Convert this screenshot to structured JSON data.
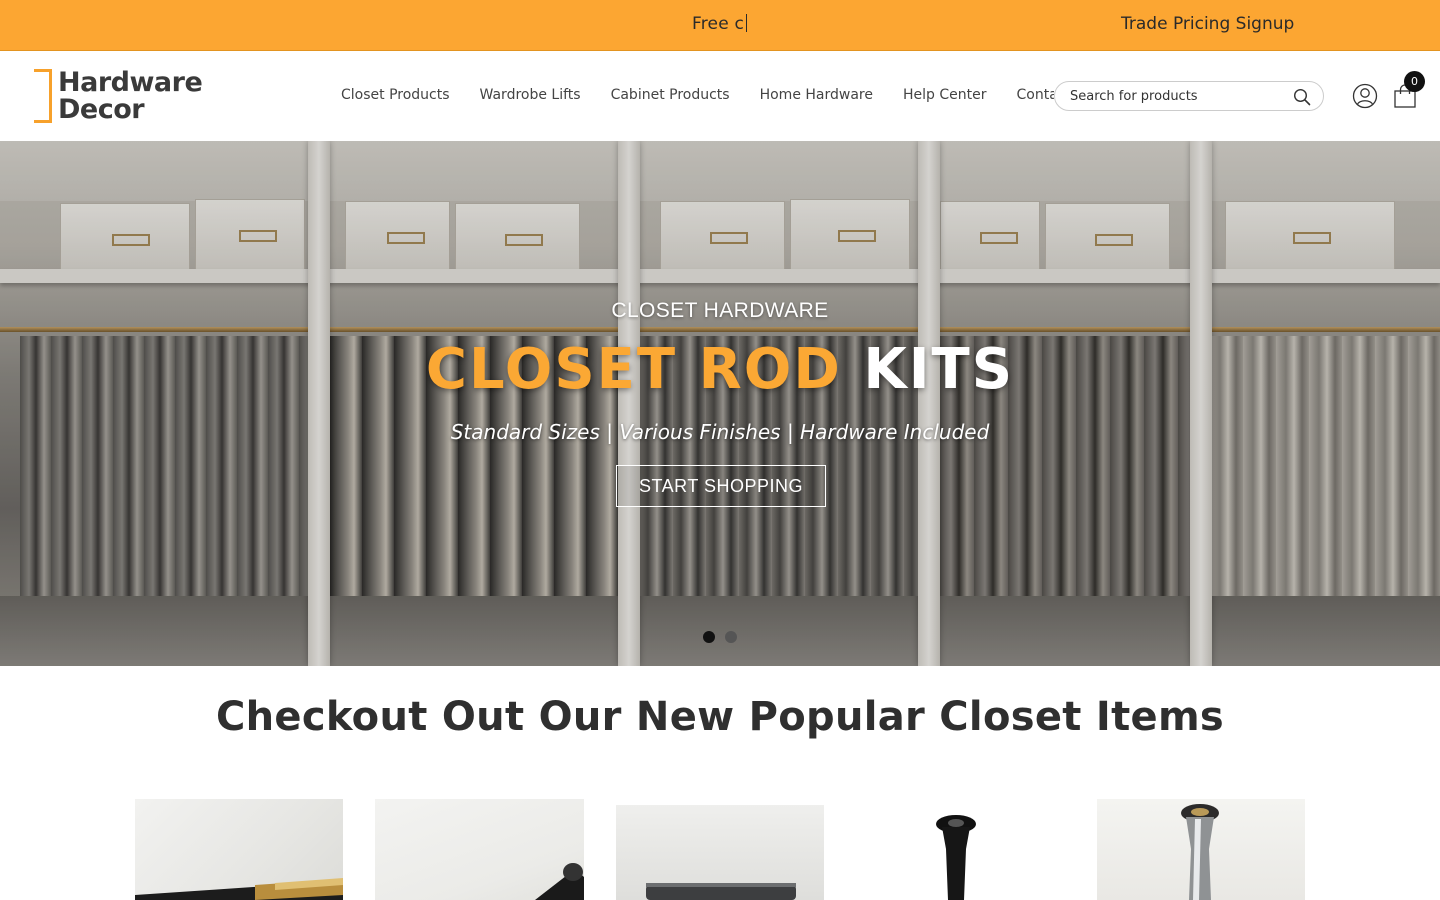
{
  "announcement": {
    "ticker_text": "Free c",
    "trade_link": "Trade Pricing Signup",
    "bar_color": "#fca632"
  },
  "header": {
    "logo": {
      "line1": "Hardware",
      "line2": "Decor",
      "accent_color": "#f7a12b"
    },
    "nav": [
      "Closet Products",
      "Wardrobe Lifts",
      "Cabinet Products",
      "Home Hardware",
      "Help Center",
      "Contact"
    ],
    "search": {
      "placeholder": "Search for products",
      "value": ""
    },
    "icons": {
      "search": "search-icon",
      "account": "user-icon",
      "cart": "shopping-bag-icon"
    },
    "cart_count": "0"
  },
  "hero": {
    "kicker": "CLOSET HARDWARE",
    "headline_accent": "CLOSET ROD",
    "headline_plain": "KITS",
    "subline": "Standard Sizes | Various Finishes | Hardware Included",
    "cta": "START SHOPPING",
    "slides": 2,
    "active_slide": 1,
    "accent_color": "#fba834"
  },
  "section": {
    "title": "Checkout Out Our New Popular Closet Items"
  },
  "products": [
    {
      "image": "gold-closet-rod-photo"
    },
    {
      "image": "black-closet-rod-photo"
    },
    {
      "image": "dark-rod-hardware-photo"
    },
    {
      "image": "black-rod-end-bracket-photo"
    },
    {
      "image": "chrome-rod-end-bracket-photo"
    }
  ]
}
